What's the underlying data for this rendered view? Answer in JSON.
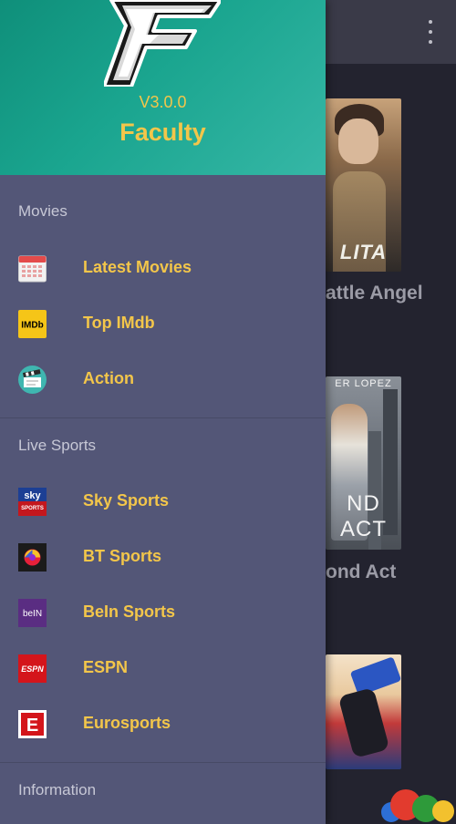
{
  "background_app": {
    "movies": [
      {
        "title_partial": "attle Angel",
        "poster_text": "LITA"
      },
      {
        "title_partial": "ond Act",
        "poster_text": "ND ACT",
        "poster_tag": "ER LOPEZ"
      },
      {
        "title_partial": ""
      }
    ],
    "overflow_icon": "more-vert-icon"
  },
  "drawer": {
    "version": "V3.0.0",
    "app_name": "Faculty",
    "logo_letter": "F",
    "sections": [
      {
        "header": "Movies",
        "items": [
          {
            "label": "Latest Movies",
            "icon": "calendar-icon"
          },
          {
            "label": "Top IMdb",
            "icon": "imdb-icon",
            "icon_text": "IMDb"
          },
          {
            "label": "Action",
            "icon": "clapperboard-icon"
          }
        ]
      },
      {
        "header": "Live Sports",
        "items": [
          {
            "label": "Sky Sports",
            "icon": "sky-sports-icon",
            "icon_text": [
              "sky",
              "SPORTS"
            ]
          },
          {
            "label": "BT Sports",
            "icon": "bt-sports-icon"
          },
          {
            "label": "BeIn Sports",
            "icon": "bein-sports-icon",
            "icon_text": "beIN"
          },
          {
            "label": "ESPN",
            "icon": "espn-icon",
            "icon_text": "ESPN"
          },
          {
            "label": "Eurosports",
            "icon": "eurosport-icon",
            "icon_text": "E"
          }
        ]
      },
      {
        "header": "Information",
        "items": []
      }
    ]
  },
  "colors": {
    "accent": "#f3c64a",
    "drawer_bg": "#535677",
    "header_gradient": [
      "#0f8f7a",
      "#36b7a6"
    ],
    "background": "#23232f"
  }
}
